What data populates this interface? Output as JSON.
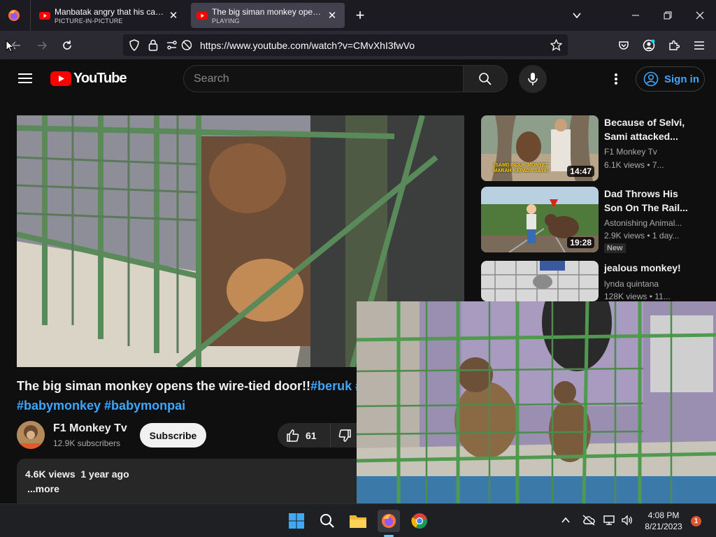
{
  "browser": {
    "tabs": [
      {
        "title": "Manbatak angry that his cage is",
        "subtitle": "PICTURE-IN-PICTURE"
      },
      {
        "title": "The big siman monkey opens the",
        "subtitle": "PLAYING"
      }
    ],
    "new_tab_symbol": "+",
    "url": "https://www.youtube.com/watch?v=CMvXhI3fwVo"
  },
  "youtube": {
    "logo_text": "YouTube",
    "search_placeholder": "Search",
    "sign_in": "Sign in"
  },
  "video": {
    "title": "The big siman monkey opens the wire-tied door!!",
    "hashtags_line1": "#beruk #",
    "hashtags_line2": "#babymonkey #babymonpai",
    "channel_name": "F1 Monkey Tv",
    "subscribers": "12.9K subscribers",
    "subscribe_label": "Subscribe",
    "likes": "61",
    "views_date": "4.6K views  1 year ago",
    "more": "...more"
  },
  "recommendations": [
    {
      "title": "Because of Selvi, Sami attacked...",
      "channel": "F1 Monkey Tv",
      "meta": "6.1K views • 7...",
      "duration": "14:47",
      "thumb_caption": "(SAMI) INDUK MONYET MARAH KEPADA SAYA!"
    },
    {
      "title": "Dad Throws His Son On The Rail...",
      "channel": "Astonishing Animal...",
      "meta": "2.9K views • 1 day...",
      "duration": "19:28",
      "badge": "New"
    },
    {
      "title": "jealous monkey!",
      "channel": "lynda quintana",
      "meta": "128K views • 11..."
    }
  ],
  "taskbar": {
    "time": "4:08 PM",
    "date": "8/21/2023",
    "notifications": "1"
  },
  "colors": {
    "accent_link": "#3ea6ff",
    "yt_red": "#ff0000",
    "background": "#0f0f0f"
  }
}
